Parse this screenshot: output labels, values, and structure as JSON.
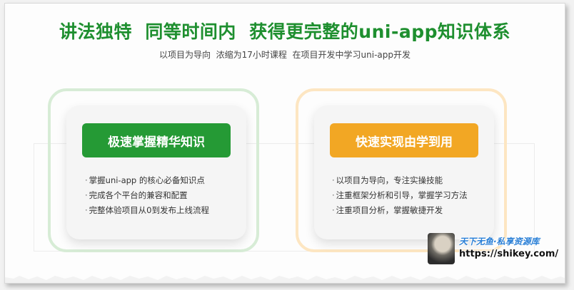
{
  "header": {
    "headline": "讲法独特  同等时间内  获得更完整的uni-app知识体系",
    "subline": "以项目为导向  浓缩为17小时课程  在项目开发中学习uni-app开发"
  },
  "cards": [
    {
      "title": "极速掌握精华知识",
      "accent": "#259a35",
      "bullets": [
        "掌握uni-app 的核心必备知识点",
        "完成各个平台的兼容和配置",
        "完整体验项目从0到发布上线流程"
      ]
    },
    {
      "title": "快速实现由学到用",
      "accent": "#f2a724",
      "bullets": [
        "以项目为导向，专注实操技能",
        "注重框架分析和引导，掌握学习方法",
        "注重项目分析，掌握敏捷开发"
      ]
    }
  ],
  "watermark": {
    "title": "天下无鱼·私享资源库",
    "url": "https://shikey.com/"
  },
  "bullet_marker": "·"
}
